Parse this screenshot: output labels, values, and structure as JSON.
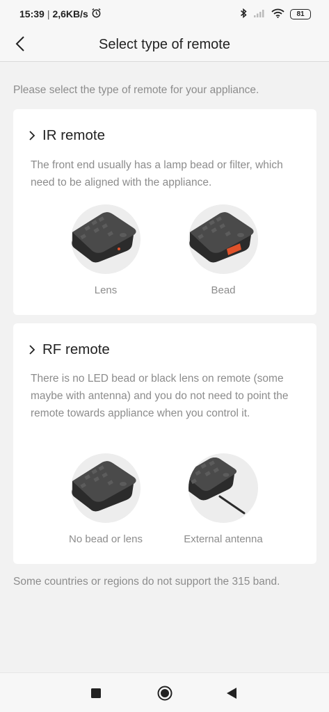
{
  "status_bar": {
    "time": "15:39",
    "separator": "|",
    "speed": "2,6KB/s",
    "battery": "81",
    "icons": [
      "alarm-icon",
      "bluetooth-icon",
      "signal-icon",
      "wifi-icon",
      "battery-icon"
    ]
  },
  "header": {
    "title": "Select type of remote",
    "back_icon": "chevron-left-icon"
  },
  "intro": "Please select the type of remote for your appliance.",
  "ir_card": {
    "title": "IR remote",
    "description": "The front end usually has a lamp bead or filter, which need to be aligned with the appliance.",
    "options": [
      {
        "label": "Lens"
      },
      {
        "label": "Bead"
      }
    ]
  },
  "rf_card": {
    "title": "RF remote",
    "description": "There is no LED bead or black lens on remote (some maybe with antenna) and you do not need to point the remote towards appliance when you control it.",
    "options": [
      {
        "label": "No bead or lens"
      },
      {
        "label": "External antenna"
      }
    ]
  },
  "footer_note": "Some countries or regions do not support the 315 band.",
  "nav_bar": {
    "icons": [
      "recents-square-icon",
      "home-circle-icon",
      "back-triangle-icon"
    ]
  },
  "colors": {
    "background": "#f2f2f2",
    "card": "#ffffff",
    "remote_body": "#3c3c3c",
    "bead_accent": "#e0522a"
  }
}
